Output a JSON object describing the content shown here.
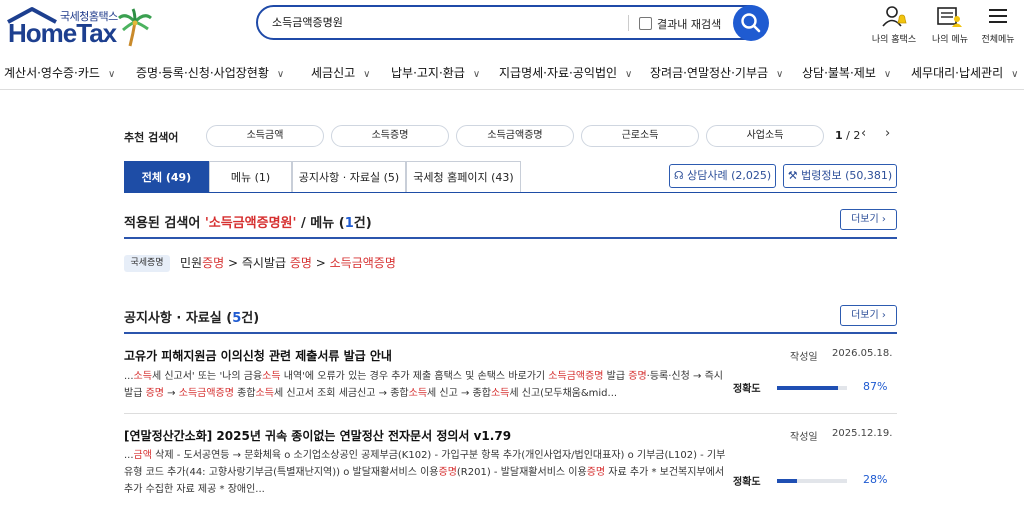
{
  "header": {
    "logo_sub": "국세청홈택스",
    "logo_main": "HomeTax",
    "search_value": "소득금액증명원",
    "recheck_label": "결과내 재검색",
    "icons": [
      {
        "label": "나의 홈택스",
        "icon": "user-bell-icon"
      },
      {
        "label": "나의 메뉴",
        "icon": "my-menu-icon"
      },
      {
        "label": "전체메뉴",
        "icon": "hamburger-icon"
      }
    ]
  },
  "nav": {
    "items": [
      {
        "label": "계산서·영수증·카드"
      },
      {
        "label": "증명·등록·신청·사업장현황"
      },
      {
        "label": "세금신고"
      },
      {
        "label": "납부·고지·환급"
      },
      {
        "label": "지급명세·자료·공익법인"
      },
      {
        "label": "장려금·연말정산·기부금"
      },
      {
        "label": "상담·불복·제보"
      },
      {
        "label": "세무대리·납세관리"
      }
    ]
  },
  "recommend": {
    "label": "추천 검색어",
    "keywords": [
      "소득금액",
      "소득증명",
      "소득금액증명",
      "근로소득",
      "사업소득"
    ],
    "page_current": "1",
    "page_sep": "/",
    "page_total": "2"
  },
  "tabs": [
    {
      "label": "전체 (49)",
      "active": true
    },
    {
      "label": "메뉴 (1)"
    },
    {
      "label": "공지사항 · 자료실 (5)"
    },
    {
      "label": "국세청 홈페이지 (43)"
    }
  ],
  "right_buttons": [
    {
      "label": "상담사례 (2,025)"
    },
    {
      "label": "법령정보 (50,381)"
    }
  ],
  "menu_section": {
    "title_prefix": "적용된 검색어 ",
    "title_keyword": "'소득금액증명원'",
    "title_mid": " / 메뉴 (",
    "title_count": "1",
    "title_suffix": "건)",
    "more_label": "더보기",
    "badge": "국세증명",
    "crumb": {
      "p1": "민원",
      "p1_hl": "증명",
      "sep1": " > 즉시발급 ",
      "p2_hl": "증명",
      "sep2": " > ",
      "p3_hl": "소득금액증명"
    }
  },
  "notice_section": {
    "title_prefix": "공지사항 · 자료실 (",
    "title_count": "5",
    "title_suffix": "건)",
    "more_label": "더보기",
    "posts": [
      {
        "title": "고유가 피해지원금 이의신청 관련 제출서류 발급 안내",
        "meta_label": "작성일",
        "date": "2026.05.18.",
        "acc_label": "정확도",
        "acc_pct": "87%",
        "accuracy": 0.87,
        "body": [
          {
            "t": "...",
            "hl": false
          },
          {
            "t": "소득",
            "hl": true
          },
          {
            "t": "세 신고서' 또는 '나의 금융",
            "hl": false
          },
          {
            "t": "소득",
            "hl": true
          },
          {
            "t": " 내역'에 오류가 있는 경우 추가 제출 홈택스 및 손택스 바로가기 ",
            "hl": false
          },
          {
            "t": "소득금액증명",
            "hl": true
          },
          {
            "t": " 발급 ",
            "hl": false
          },
          {
            "t": "증명",
            "hl": true
          },
          {
            "t": "·등록·신청 → 즉시발급 ",
            "hl": false
          },
          {
            "t": "증명",
            "hl": true
          },
          {
            "t": " → ",
            "hl": false
          },
          {
            "t": "소득금액증명",
            "hl": true
          },
          {
            "t": " 종합",
            "hl": false
          },
          {
            "t": "소득",
            "hl": true
          },
          {
            "t": "세 신고서 조회 세금신고 → 종합",
            "hl": false
          },
          {
            "t": "소득",
            "hl": true
          },
          {
            "t": "세 신고 → 종합",
            "hl": false
          },
          {
            "t": "소득",
            "hl": true
          },
          {
            "t": "세 신고(모두채움&mid...",
            "hl": false
          }
        ]
      },
      {
        "title": "[연말정산간소화] 2025년 귀속 종이없는 연말정산 전자문서 정의서 v1.79",
        "meta_label": "작성일",
        "date": "2025.12.19.",
        "acc_label": "정확도",
        "acc_pct": "28%",
        "accuracy": 0.28,
        "body": [
          {
            "t": "...",
            "hl": false
          },
          {
            "t": "금액",
            "hl": true
          },
          {
            "t": " 삭제 - 도서공연등 → 문화체육 ο 소기업소상공인 공제부금(K102) - 가입구분 항목 추가(개인사업자/법인대표자) ο 기부금(L102) - 기부유형 코드 추가(44: 고향사랑기부금(특별재난지역)) ο 발달재활서비스 이용",
            "hl": false
          },
          {
            "t": "증명",
            "hl": true
          },
          {
            "t": "(R201) - 발달재활서비스 이용",
            "hl": false
          },
          {
            "t": "증명",
            "hl": true
          },
          {
            "t": " 자료 추가 * 보건복지부에서 추가 수집한 자료 제공 * 장애인...",
            "hl": false
          }
        ]
      }
    ]
  },
  "colors": {
    "brand_blue": "#1e4da6",
    "highlight_red": "#d63030",
    "accent_blue": "#1f5bd1"
  }
}
